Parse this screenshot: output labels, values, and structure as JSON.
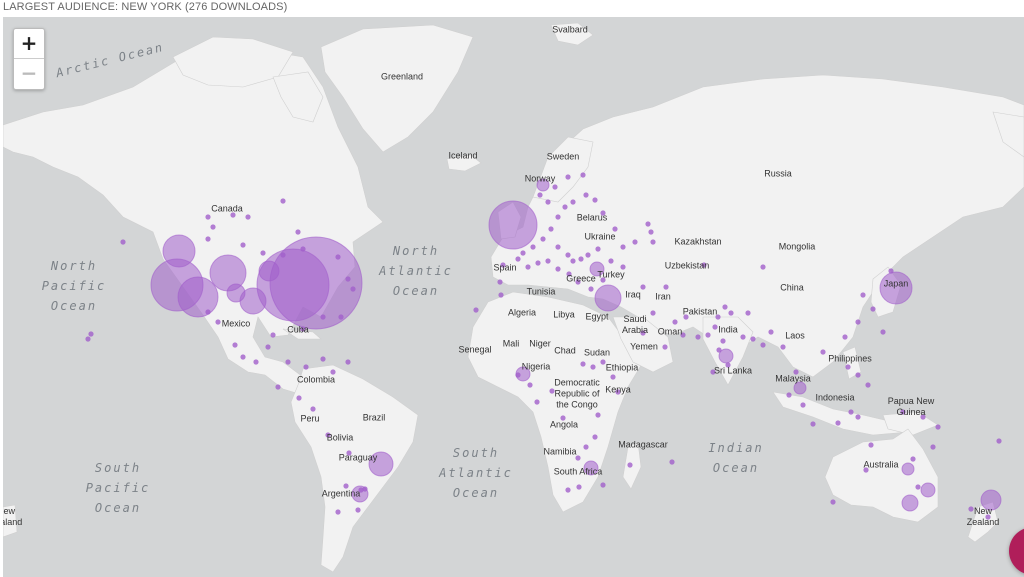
{
  "caption": "LARGEST AUDIENCE: NEW YORK (276 DOWNLOADS)",
  "zoom": {
    "in_label": "+",
    "out_label": "−"
  },
  "colors": {
    "ocean": "#d3d5d6",
    "land": "#f2f2f2",
    "bubble": "#a15fcb",
    "fab": "#b01e5a"
  },
  "countries": [
    {
      "key": "svalbard",
      "text": "Svalbard"
    },
    {
      "key": "greenland",
      "text": "Greenland"
    },
    {
      "key": "iceland",
      "text": "Iceland"
    },
    {
      "key": "sweden",
      "text": "Sweden"
    },
    {
      "key": "norway",
      "text": "Norway"
    },
    {
      "key": "russia",
      "text": "Russia"
    },
    {
      "key": "canada",
      "text": "Canada"
    },
    {
      "key": "belarus",
      "text": "Belarus"
    },
    {
      "key": "ukraine",
      "text": "Ukraine"
    },
    {
      "key": "kazakhstan",
      "text": "Kazakhstan"
    },
    {
      "key": "mongolia",
      "text": "Mongolia"
    },
    {
      "key": "uzbekistan",
      "text": "Uzbekistan"
    },
    {
      "key": "spain",
      "text": "Spain"
    },
    {
      "key": "greece",
      "text": "Greece"
    },
    {
      "key": "turkey",
      "text": "Turkey"
    },
    {
      "key": "tunisia",
      "text": "Tunisia"
    },
    {
      "key": "iraq",
      "text": "Iraq"
    },
    {
      "key": "iran",
      "text": "Iran"
    },
    {
      "key": "china",
      "text": "China"
    },
    {
      "key": "japan",
      "text": "Japan"
    },
    {
      "key": "algeria",
      "text": "Algeria"
    },
    {
      "key": "libya",
      "text": "Libya"
    },
    {
      "key": "egypt",
      "text": "Egypt"
    },
    {
      "key": "saudi",
      "text": "Saudi\nArabia"
    },
    {
      "key": "pakistan",
      "text": "Pakistan"
    },
    {
      "key": "india",
      "text": "India"
    },
    {
      "key": "oman",
      "text": "Oman"
    },
    {
      "key": "mexico",
      "text": "Mexico"
    },
    {
      "key": "cuba",
      "text": "Cuba"
    },
    {
      "key": "laos",
      "text": "Laos"
    },
    {
      "key": "senegal",
      "text": "Senegal"
    },
    {
      "key": "mali",
      "text": "Mali"
    },
    {
      "key": "niger",
      "text": "Niger"
    },
    {
      "key": "chad",
      "text": "Chad"
    },
    {
      "key": "sudan",
      "text": "Sudan"
    },
    {
      "key": "yemen",
      "text": "Yemen"
    },
    {
      "key": "philippines",
      "text": "Philippines"
    },
    {
      "key": "ethiopia",
      "text": "Ethiopia"
    },
    {
      "key": "nigeria",
      "text": "Nigeria"
    },
    {
      "key": "srilanka",
      "text": "Sri Lanka"
    },
    {
      "key": "colombia",
      "text": "Colombia"
    },
    {
      "key": "drc",
      "text": "Democratic\nRepublic of\nthe Congo"
    },
    {
      "key": "kenya",
      "text": "Kenya"
    },
    {
      "key": "malaysia",
      "text": "Malaysia"
    },
    {
      "key": "brazil",
      "text": "Brazil"
    },
    {
      "key": "peru",
      "text": "Peru"
    },
    {
      "key": "indonesia",
      "text": "Indonesia"
    },
    {
      "key": "png",
      "text": "Papua New\nGuinea"
    },
    {
      "key": "bolivia",
      "text": "Bolivia"
    },
    {
      "key": "angola",
      "text": "Angola"
    },
    {
      "key": "namibia",
      "text": "Namibia"
    },
    {
      "key": "madagascar",
      "text": "Madagascar"
    },
    {
      "key": "paraguay",
      "text": "Paraguay"
    },
    {
      "key": "australia",
      "text": "Australia"
    },
    {
      "key": "southafrica",
      "text": "South Africa"
    },
    {
      "key": "argentina",
      "text": "Argentina"
    },
    {
      "key": "newzealand",
      "text": "New\nZealand"
    },
    {
      "key": "nz_left",
      "text": "New\nZealand"
    }
  ],
  "oceans": [
    {
      "key": "arctic",
      "text": "Arctic Ocean"
    },
    {
      "key": "npac",
      "text": "North\nPacific\nOcean"
    },
    {
      "key": "natl",
      "text": "North\nAtlantic\nOcean"
    },
    {
      "key": "satl",
      "text": "South\nAtlantic\nOcean"
    },
    {
      "key": "indian",
      "text": "Indian\nOcean"
    },
    {
      "key": "spac",
      "text": "South\nPacific\nOcean"
    }
  ],
  "audience_markers": [
    {
      "place": "New York",
      "downloads": 276
    }
  ]
}
